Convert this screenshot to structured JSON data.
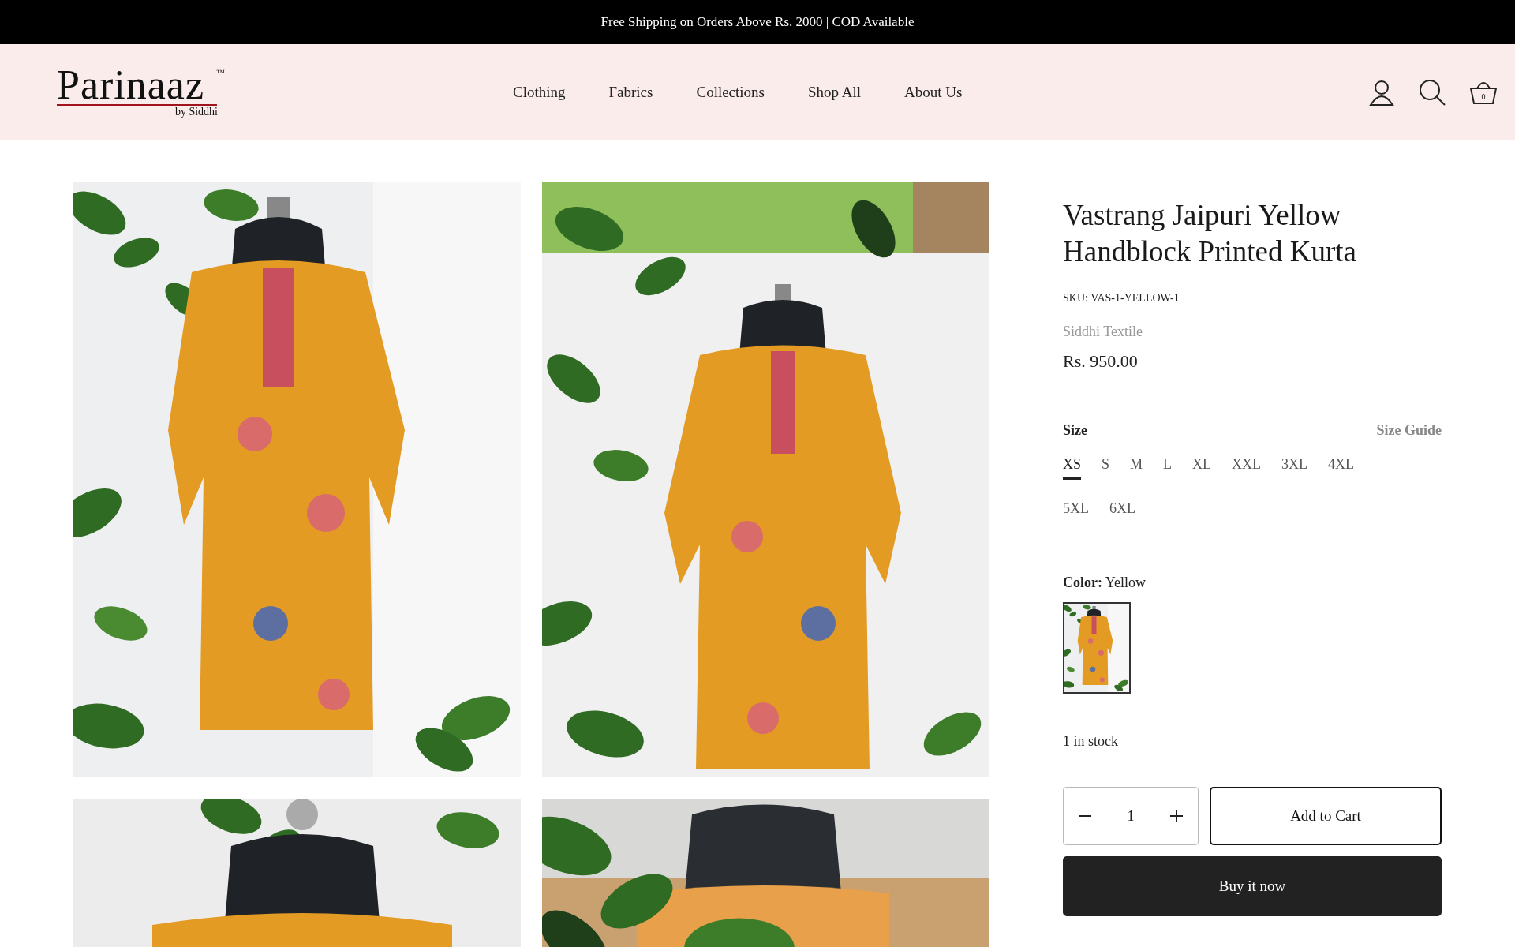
{
  "announcement": "Free Shipping on Orders Above Rs. 2000 | COD Available",
  "logo": {
    "name": "Parinaaz",
    "trademark": "™",
    "tagline": "by Siddhi"
  },
  "nav": [
    "Clothing",
    "Fabrics",
    "Collections",
    "Shop All",
    "About Us"
  ],
  "cart_count": "0",
  "product": {
    "title": "Vastrang Jaipuri Yellow Handblock Printed Kurta",
    "sku": "SKU: VAS-1-YELLOW-1",
    "vendor": "Siddhi Textile",
    "price": "Rs. 950.00",
    "size_label": "Size",
    "size_guide": "Size Guide",
    "sizes": [
      {
        "label": "XS",
        "selected": true
      },
      {
        "label": "S",
        "selected": false
      },
      {
        "label": "M",
        "selected": false
      },
      {
        "label": "L",
        "selected": false
      },
      {
        "label": "XL",
        "selected": false
      },
      {
        "label": "XXL",
        "selected": false
      },
      {
        "label": "3XL",
        "selected": false
      },
      {
        "label": "4XL",
        "selected": false
      },
      {
        "label": "5XL",
        "selected": false
      },
      {
        "label": "6XL",
        "selected": false
      }
    ],
    "color_label": "Color:",
    "color_value": "Yellow",
    "swatches": [
      {
        "selected": true
      }
    ],
    "stock": "1 in stock",
    "quantity": "1",
    "add_to_cart": "Add to Cart",
    "buy_now": "Buy it now"
  }
}
